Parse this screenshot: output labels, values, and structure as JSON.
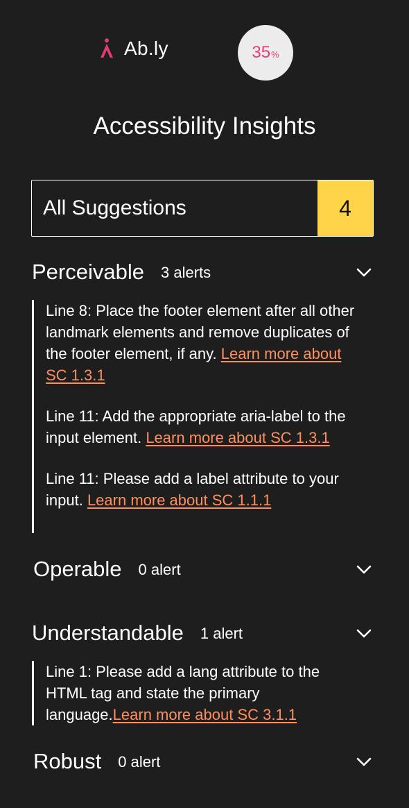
{
  "brand": {
    "name": "Ab.ly",
    "accent_color": "#e03e72"
  },
  "score": {
    "value": "35",
    "unit": "%"
  },
  "title": "Accessibility Insights",
  "filter": {
    "label": "All Suggestions",
    "count": "4",
    "count_color": "#ffd448"
  },
  "link_color": "#ff8f5e",
  "sections": {
    "perceivable": {
      "name": "Perceivable",
      "count": "3 alerts",
      "alerts": [
        {
          "text": "Line 8: Place the footer element after all other landmark elements and remove duplicates of the footer element, if any.",
          "link": "Learn more about SC 1.3.1"
        },
        {
          "text": "Line 11: Add the appropriate aria-label to the input element. ",
          "link": "Learn more about SC 1.3.1"
        },
        {
          "text": "Line 11: Please add a label attribute to your input. ",
          "link": "Learn more about SC 1.1.1"
        }
      ]
    },
    "operable": {
      "name": "Operable",
      "count": "0 alert"
    },
    "understandable": {
      "name": "Understandable",
      "count": "1 alert",
      "alerts": [
        {
          "text": "Line 1: Please add a lang attribute to the HTML tag and state the primary language.",
          "link": "Learn more about SC 3.1.1"
        }
      ]
    },
    "robust": {
      "name": "Robust",
      "count": "0 alert"
    }
  },
  "icons": {
    "logo": "ably-logo-mark-icon",
    "chevron": "chevron-down-icon"
  }
}
